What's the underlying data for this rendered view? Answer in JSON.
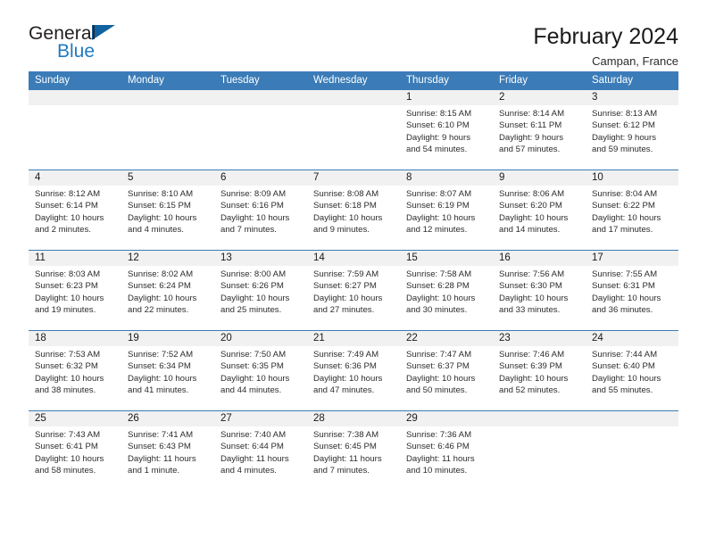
{
  "brand": {
    "word_one": "General",
    "word_two": "Blue",
    "logo_icon": "blue-triangle-icon",
    "accent_color": "#1f7ac0"
  },
  "header": {
    "title": "February 2024",
    "subtitle": "Campan, France"
  },
  "theme": {
    "header_blue": "#3b7cb8",
    "daynum_band": "#f1f1f1",
    "cell_bg": "#ffffff",
    "text": "#2c2c2c"
  },
  "calendar": {
    "day_names": [
      "Sunday",
      "Monday",
      "Tuesday",
      "Wednesday",
      "Thursday",
      "Friday",
      "Saturday"
    ],
    "labels": {
      "sunrise": "Sunrise:",
      "sunset": "Sunset:",
      "daylight": "Daylight:"
    },
    "weeks": [
      [
        {
          "day": "",
          "lines": []
        },
        {
          "day": "",
          "lines": []
        },
        {
          "day": "",
          "lines": []
        },
        {
          "day": "",
          "lines": []
        },
        {
          "day": "1",
          "lines": [
            "Sunrise: 8:15 AM",
            "Sunset: 6:10 PM",
            "Daylight: 9 hours",
            "and 54 minutes."
          ]
        },
        {
          "day": "2",
          "lines": [
            "Sunrise: 8:14 AM",
            "Sunset: 6:11 PM",
            "Daylight: 9 hours",
            "and 57 minutes."
          ]
        },
        {
          "day": "3",
          "lines": [
            "Sunrise: 8:13 AM",
            "Sunset: 6:12 PM",
            "Daylight: 9 hours",
            "and 59 minutes."
          ]
        }
      ],
      [
        {
          "day": "4",
          "lines": [
            "Sunrise: 8:12 AM",
            "Sunset: 6:14 PM",
            "Daylight: 10 hours",
            "and 2 minutes."
          ]
        },
        {
          "day": "5",
          "lines": [
            "Sunrise: 8:10 AM",
            "Sunset: 6:15 PM",
            "Daylight: 10 hours",
            "and 4 minutes."
          ]
        },
        {
          "day": "6",
          "lines": [
            "Sunrise: 8:09 AM",
            "Sunset: 6:16 PM",
            "Daylight: 10 hours",
            "and 7 minutes."
          ]
        },
        {
          "day": "7",
          "lines": [
            "Sunrise: 8:08 AM",
            "Sunset: 6:18 PM",
            "Daylight: 10 hours",
            "and 9 minutes."
          ]
        },
        {
          "day": "8",
          "lines": [
            "Sunrise: 8:07 AM",
            "Sunset: 6:19 PM",
            "Daylight: 10 hours",
            "and 12 minutes."
          ]
        },
        {
          "day": "9",
          "lines": [
            "Sunrise: 8:06 AM",
            "Sunset: 6:20 PM",
            "Daylight: 10 hours",
            "and 14 minutes."
          ]
        },
        {
          "day": "10",
          "lines": [
            "Sunrise: 8:04 AM",
            "Sunset: 6:22 PM",
            "Daylight: 10 hours",
            "and 17 minutes."
          ]
        }
      ],
      [
        {
          "day": "11",
          "lines": [
            "Sunrise: 8:03 AM",
            "Sunset: 6:23 PM",
            "Daylight: 10 hours",
            "and 19 minutes."
          ]
        },
        {
          "day": "12",
          "lines": [
            "Sunrise: 8:02 AM",
            "Sunset: 6:24 PM",
            "Daylight: 10 hours",
            "and 22 minutes."
          ]
        },
        {
          "day": "13",
          "lines": [
            "Sunrise: 8:00 AM",
            "Sunset: 6:26 PM",
            "Daylight: 10 hours",
            "and 25 minutes."
          ]
        },
        {
          "day": "14",
          "lines": [
            "Sunrise: 7:59 AM",
            "Sunset: 6:27 PM",
            "Daylight: 10 hours",
            "and 27 minutes."
          ]
        },
        {
          "day": "15",
          "lines": [
            "Sunrise: 7:58 AM",
            "Sunset: 6:28 PM",
            "Daylight: 10 hours",
            "and 30 minutes."
          ]
        },
        {
          "day": "16",
          "lines": [
            "Sunrise: 7:56 AM",
            "Sunset: 6:30 PM",
            "Daylight: 10 hours",
            "and 33 minutes."
          ]
        },
        {
          "day": "17",
          "lines": [
            "Sunrise: 7:55 AM",
            "Sunset: 6:31 PM",
            "Daylight: 10 hours",
            "and 36 minutes."
          ]
        }
      ],
      [
        {
          "day": "18",
          "lines": [
            "Sunrise: 7:53 AM",
            "Sunset: 6:32 PM",
            "Daylight: 10 hours",
            "and 38 minutes."
          ]
        },
        {
          "day": "19",
          "lines": [
            "Sunrise: 7:52 AM",
            "Sunset: 6:34 PM",
            "Daylight: 10 hours",
            "and 41 minutes."
          ]
        },
        {
          "day": "20",
          "lines": [
            "Sunrise: 7:50 AM",
            "Sunset: 6:35 PM",
            "Daylight: 10 hours",
            "and 44 minutes."
          ]
        },
        {
          "day": "21",
          "lines": [
            "Sunrise: 7:49 AM",
            "Sunset: 6:36 PM",
            "Daylight: 10 hours",
            "and 47 minutes."
          ]
        },
        {
          "day": "22",
          "lines": [
            "Sunrise: 7:47 AM",
            "Sunset: 6:37 PM",
            "Daylight: 10 hours",
            "and 50 minutes."
          ]
        },
        {
          "day": "23",
          "lines": [
            "Sunrise: 7:46 AM",
            "Sunset: 6:39 PM",
            "Daylight: 10 hours",
            "and 52 minutes."
          ]
        },
        {
          "day": "24",
          "lines": [
            "Sunrise: 7:44 AM",
            "Sunset: 6:40 PM",
            "Daylight: 10 hours",
            "and 55 minutes."
          ]
        }
      ],
      [
        {
          "day": "25",
          "lines": [
            "Sunrise: 7:43 AM",
            "Sunset: 6:41 PM",
            "Daylight: 10 hours",
            "and 58 minutes."
          ]
        },
        {
          "day": "26",
          "lines": [
            "Sunrise: 7:41 AM",
            "Sunset: 6:43 PM",
            "Daylight: 11 hours",
            "and 1 minute."
          ]
        },
        {
          "day": "27",
          "lines": [
            "Sunrise: 7:40 AM",
            "Sunset: 6:44 PM",
            "Daylight: 11 hours",
            "and 4 minutes."
          ]
        },
        {
          "day": "28",
          "lines": [
            "Sunrise: 7:38 AM",
            "Sunset: 6:45 PM",
            "Daylight: 11 hours",
            "and 7 minutes."
          ]
        },
        {
          "day": "29",
          "lines": [
            "Sunrise: 7:36 AM",
            "Sunset: 6:46 PM",
            "Daylight: 11 hours",
            "and 10 minutes."
          ]
        },
        {
          "day": "",
          "lines": []
        },
        {
          "day": "",
          "lines": []
        }
      ]
    ]
  }
}
